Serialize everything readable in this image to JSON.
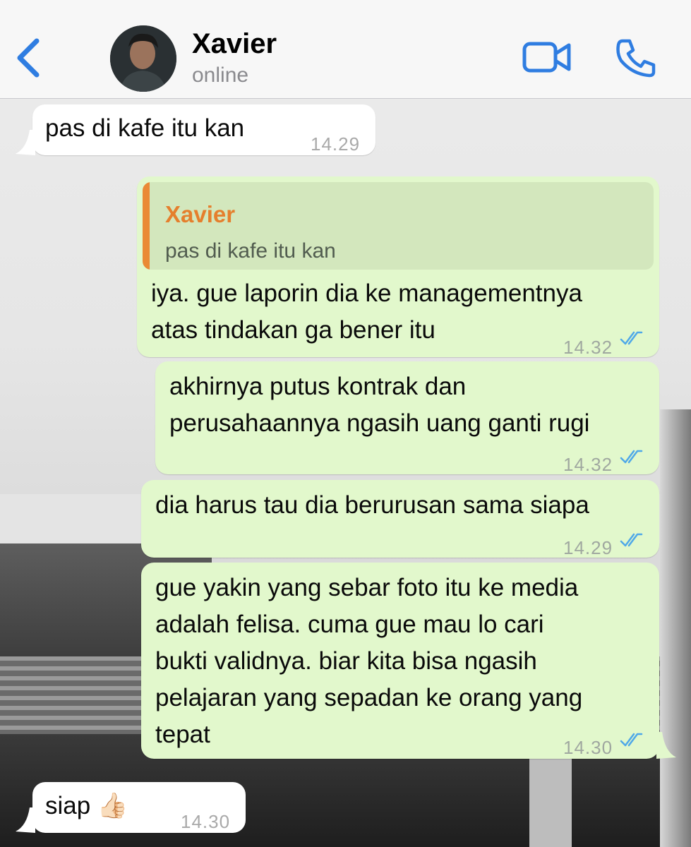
{
  "header": {
    "contact_name": "Xavier",
    "status": "online"
  },
  "colors": {
    "accent_blue": "#2f7de1",
    "outgoing_bubble": "#e2f8cc",
    "incoming_bubble": "#ffffff",
    "quote_name": "#e57f2d",
    "read_ticks": "#4fa8e8"
  },
  "icons": {
    "back": "chevron-left-icon",
    "video": "video-camera-icon",
    "call": "phone-icon",
    "read": "double-check-icon"
  },
  "messages": [
    {
      "direction": "incoming",
      "text": "pas di kafe itu kan",
      "time": "14.29"
    },
    {
      "direction": "outgoing",
      "reply_to": {
        "name": "Xavier",
        "text": "pas di kafe itu kan"
      },
      "text": "iya. gue laporin dia ke managementnya\natas tindakan ga bener itu",
      "time": "14.32",
      "read": true
    },
    {
      "direction": "outgoing",
      "text": "akhirnya putus kontrak dan\nperusahaannya ngasih uang ganti rugi",
      "time": "14.32",
      "read": true
    },
    {
      "direction": "outgoing",
      "text": "dia harus tau dia berurusan sama siapa",
      "time": "14.29",
      "read": true
    },
    {
      "direction": "outgoing",
      "text": "gue yakin yang sebar foto itu ke media\nadalah felisa. cuma gue mau lo cari\nbukti validnya. biar kita bisa ngasih\npelajaran yang sepadan ke orang yang\ntepat",
      "time": "14.30",
      "read": true
    },
    {
      "direction": "incoming",
      "text": "siap 👍🏻",
      "time": "14.30"
    }
  ]
}
